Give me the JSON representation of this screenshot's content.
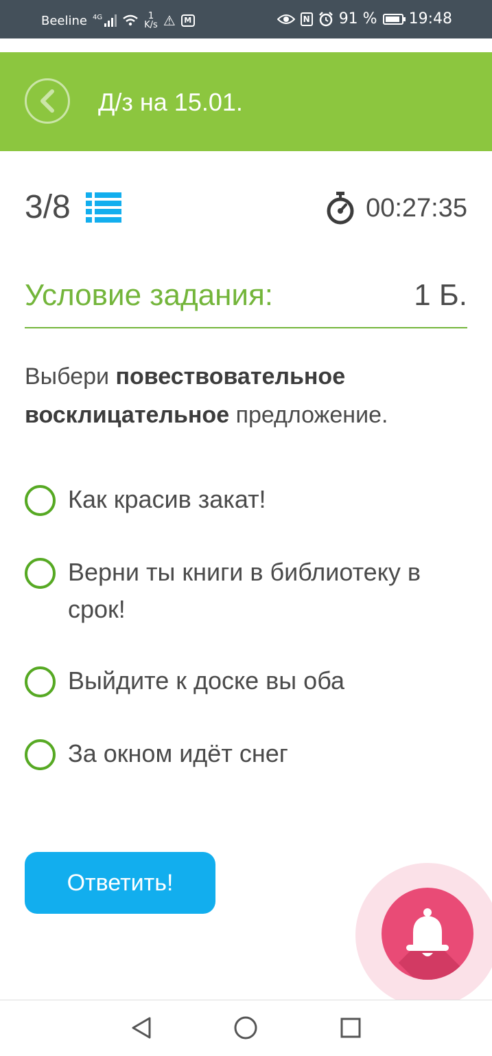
{
  "status_bar": {
    "carrier": "Beeline",
    "network": "4G",
    "speed_value": "1",
    "speed_unit": "K/s",
    "battery": "91 %",
    "time": "19:48"
  },
  "header": {
    "title": "Д/з на 15.01."
  },
  "progress": {
    "current": "3",
    "separator": "/",
    "total": "8",
    "timer": "00:27:35"
  },
  "condition": {
    "title": "Условие задания:",
    "points": "1 Б."
  },
  "question": {
    "prefix": "Выбери ",
    "bold": "повествовательное восклицательное",
    "suffix": " предложение."
  },
  "options": [
    {
      "label": "Как красив закат!"
    },
    {
      "label": "Верни ты книги в библиотеку в срок!"
    },
    {
      "label": "Выйдите к доске вы оба"
    },
    {
      "label": "За окном идёт снег"
    }
  ],
  "answer_button": {
    "label": "Ответить!"
  },
  "colors": {
    "header_green": "#8cc63f",
    "accent_green": "#56a923",
    "button_blue": "#12aeee",
    "fab_pink": "#e94b76"
  },
  "icons": {
    "back": "chevron-left-icon",
    "list": "list-icon",
    "timer": "stopwatch-icon",
    "notification": "bell-icon"
  }
}
